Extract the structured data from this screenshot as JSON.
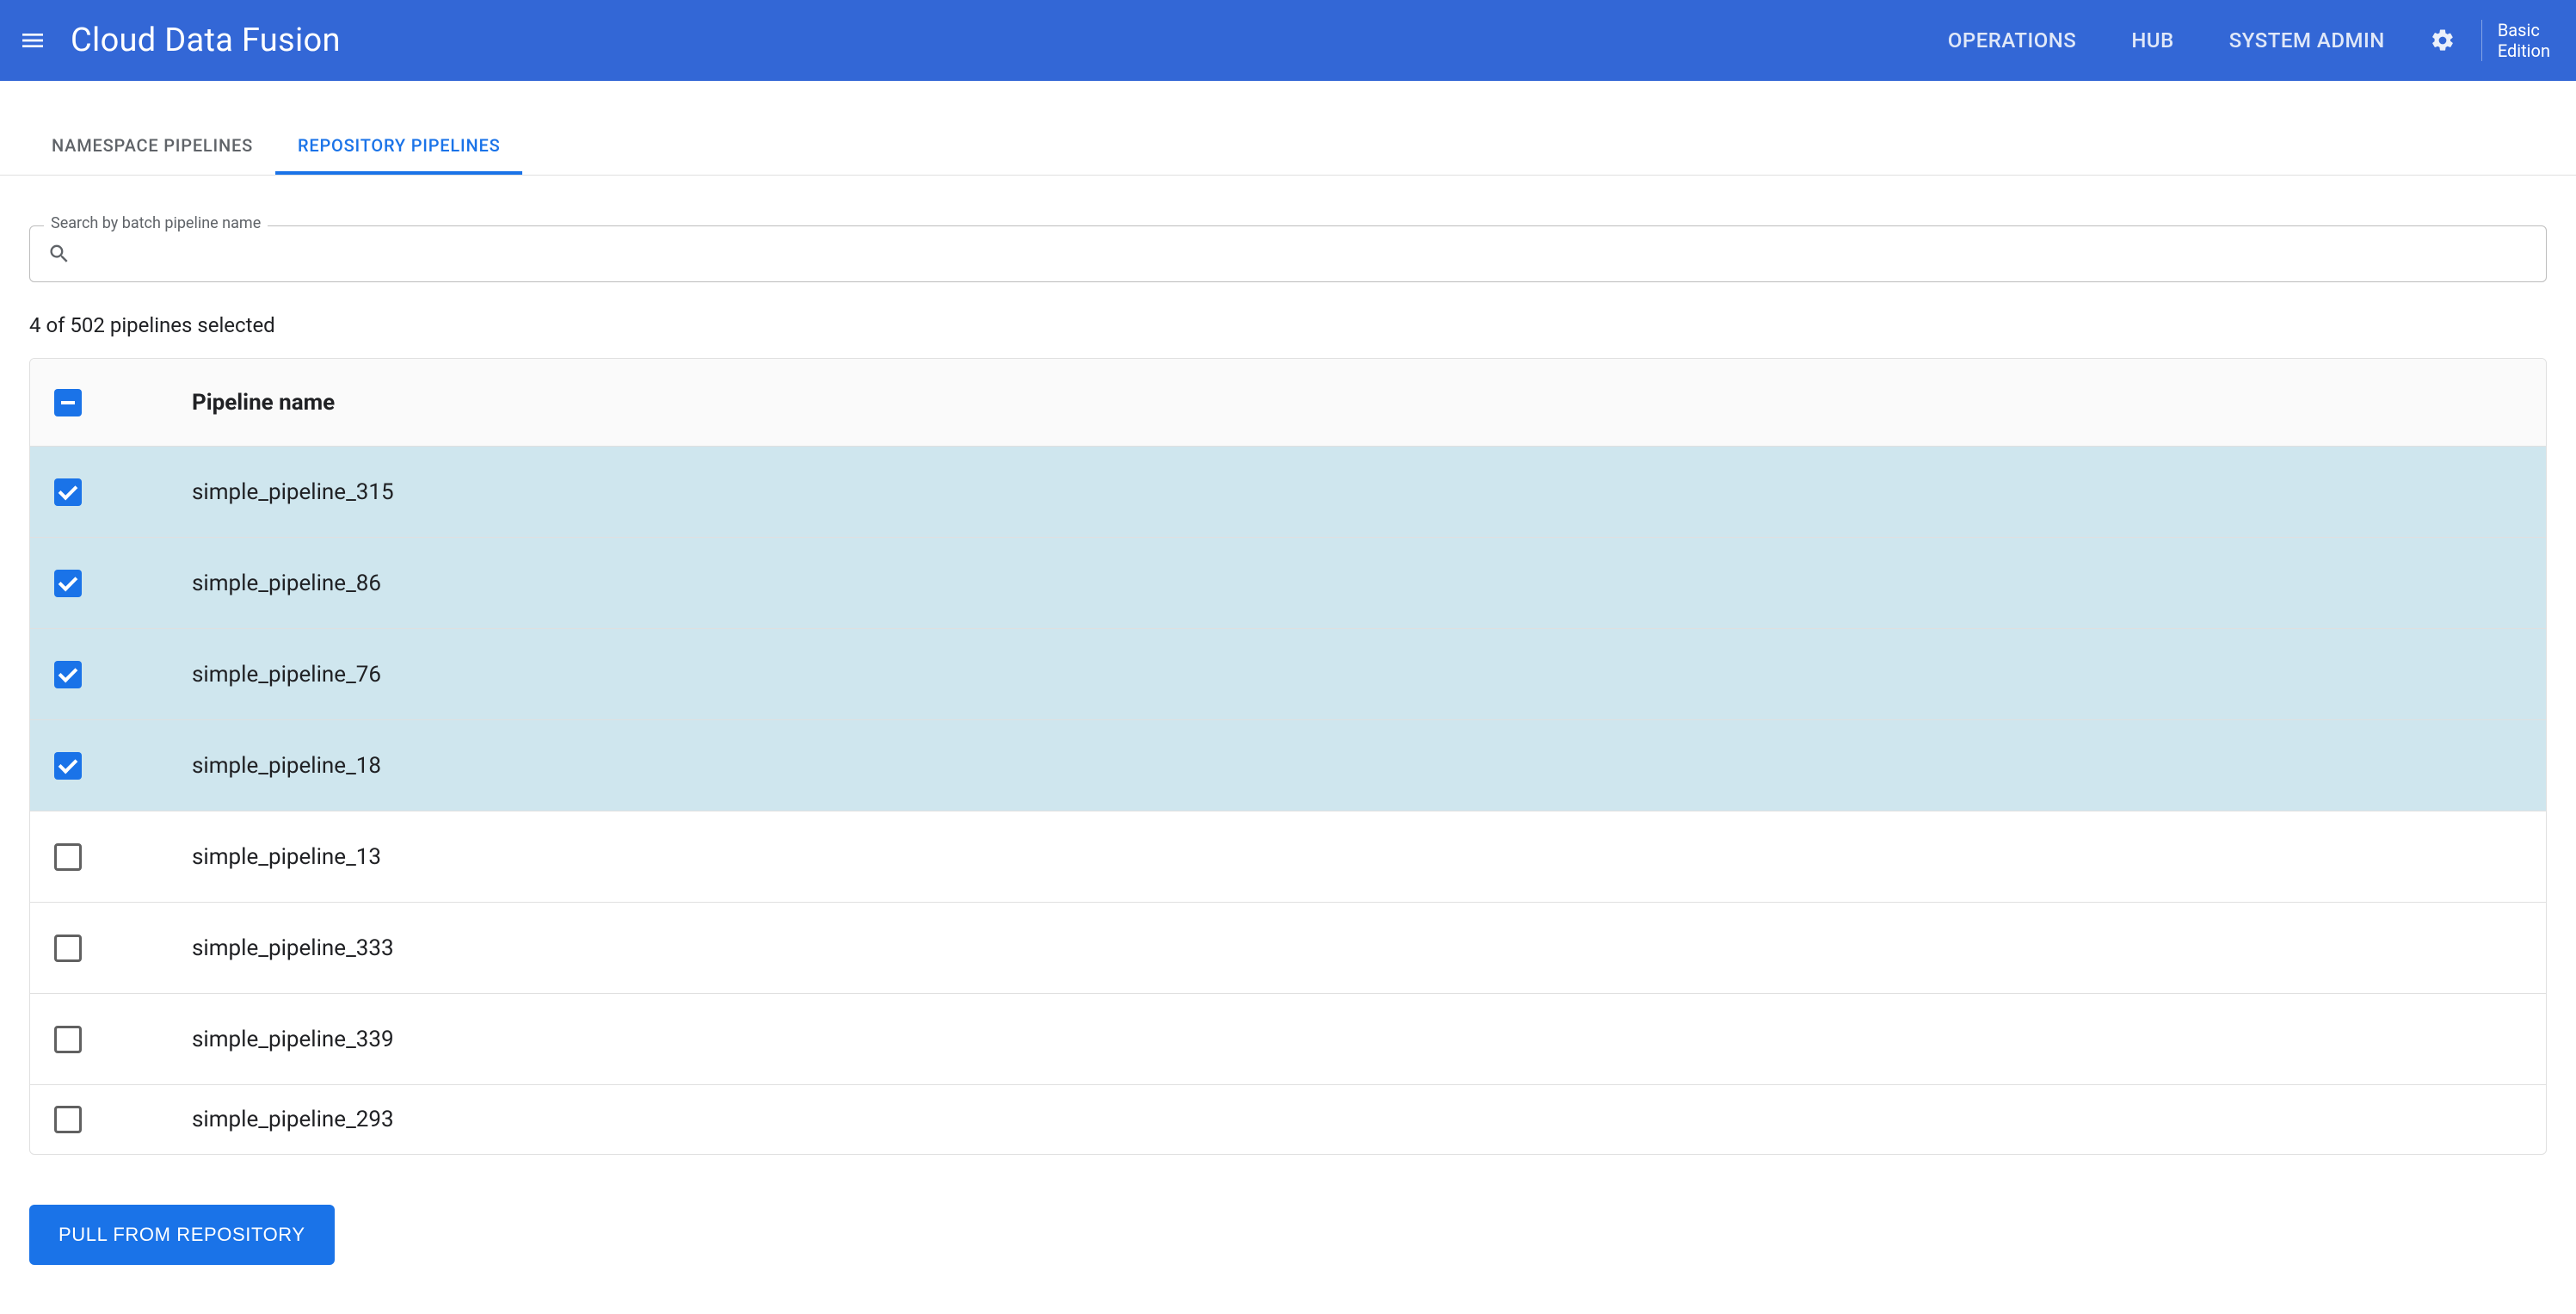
{
  "appbar": {
    "brand": "Cloud Data Fusion",
    "nav": [
      {
        "label": "OPERATIONS"
      },
      {
        "label": "HUB"
      },
      {
        "label": "SYSTEM ADMIN"
      }
    ],
    "edition_line1": "Basic",
    "edition_line2": "Edition"
  },
  "tabs": [
    {
      "label": "NAMESPACE PIPELINES",
      "active": false
    },
    {
      "label": "REPOSITORY PIPELINES",
      "active": true
    }
  ],
  "search": {
    "label": "Search by batch pipeline name",
    "value": ""
  },
  "selection_summary": "4 of 502 pipelines selected",
  "table": {
    "header": "Pipeline name",
    "rows": [
      {
        "name": "simple_pipeline_315",
        "selected": true
      },
      {
        "name": "simple_pipeline_86",
        "selected": true
      },
      {
        "name": "simple_pipeline_76",
        "selected": true
      },
      {
        "name": "simple_pipeline_18",
        "selected": true
      },
      {
        "name": "simple_pipeline_13",
        "selected": false
      },
      {
        "name": "simple_pipeline_333",
        "selected": false
      },
      {
        "name": "simple_pipeline_339",
        "selected": false
      },
      {
        "name": "simple_pipeline_293",
        "selected": false
      }
    ]
  },
  "action_button": "PULL FROM REPOSITORY"
}
